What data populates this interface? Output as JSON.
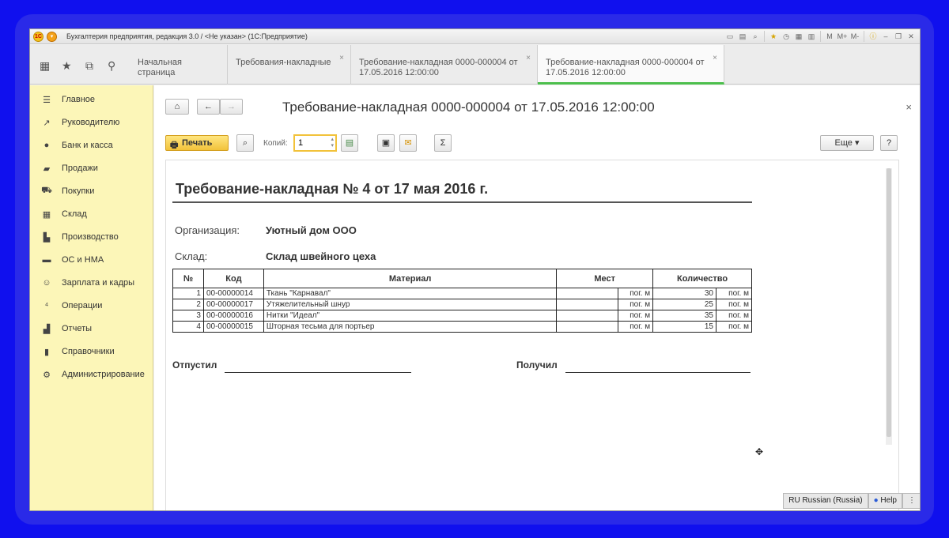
{
  "window": {
    "title": "Бухгалтерия предприятия, редакция 3.0 / <Не указан>  (1С:Предприятие)",
    "toolbar_icons": [
      "save-icon",
      "print-icon",
      "preview-icon",
      "favorite-icon",
      "history-icon",
      "calendar-icon",
      "calculator-icon"
    ],
    "mem_labels": [
      "M",
      "M+",
      "M-"
    ]
  },
  "tabs": [
    {
      "label": "Начальная страница",
      "closable": false
    },
    {
      "label": "Требования-накладные",
      "closable": true
    },
    {
      "label": "Требование-накладная 0000-000004 от 17.05.2016 12:00:00",
      "closable": true
    },
    {
      "label": "Требование-накладная 0000-000004 от 17.05.2016 12:00:00",
      "closable": true,
      "active": true
    }
  ],
  "sidebar": {
    "items": [
      {
        "label": "Главное",
        "icon": "menu-icon"
      },
      {
        "label": "Руководителю",
        "icon": "chart-icon"
      },
      {
        "label": "Банк и касса",
        "icon": "coin-icon"
      },
      {
        "label": "Продажи",
        "icon": "bag-icon"
      },
      {
        "label": "Покупки",
        "icon": "cart-icon"
      },
      {
        "label": "Склад",
        "icon": "warehouse-icon"
      },
      {
        "label": "Производство",
        "icon": "factory-icon"
      },
      {
        "label": "ОС и НМА",
        "icon": "truck-icon"
      },
      {
        "label": "Зарплата и кадры",
        "icon": "people-icon"
      },
      {
        "label": "Операции",
        "icon": "operations-icon"
      },
      {
        "label": "Отчеты",
        "icon": "reports-icon"
      },
      {
        "label": "Справочники",
        "icon": "books-icon"
      },
      {
        "label": "Администрирование",
        "icon": "gear-icon"
      }
    ]
  },
  "doc": {
    "title": "Требование-накладная 0000-000004 от 17.05.2016 12:00:00",
    "print_label": "Печать",
    "copies_label": "Копий:",
    "copies_value": "1",
    "more_label": "Еще",
    "help_label": "?"
  },
  "invoice": {
    "title": "Требование-накладная № 4 от 17 мая 2016 г.",
    "org_label": "Организация:",
    "org_value": "Уютный дом ООО",
    "wh_label": "Склад:",
    "wh_value": "Склад швейного цеха",
    "headers": [
      "№",
      "Код",
      "Материал",
      "Мест",
      "Количество"
    ],
    "rows": [
      {
        "n": "1",
        "code": "00-00000014",
        "material": "Ткань \"Карнавал\"",
        "places_unit": "пог. м",
        "qty": "30",
        "qty_unit": "пог. м"
      },
      {
        "n": "2",
        "code": "00-00000017",
        "material": "Утяжелительный шнур",
        "places_unit": "пог. м",
        "qty": "25",
        "qty_unit": "пог. м"
      },
      {
        "n": "3",
        "code": "00-00000016",
        "material": "Нитки \"Идеал\"",
        "places_unit": "пог. м",
        "qty": "35",
        "qty_unit": "пог. м"
      },
      {
        "n": "4",
        "code": "00-00000015",
        "material": "Шторная тесьма для портьер",
        "places_unit": "пог. м",
        "qty": "15",
        "qty_unit": "пог. м"
      }
    ],
    "released_label": "Отпустил",
    "received_label": "Получил"
  },
  "status": {
    "language": "RU Russian (Russia)",
    "help": "Help"
  }
}
